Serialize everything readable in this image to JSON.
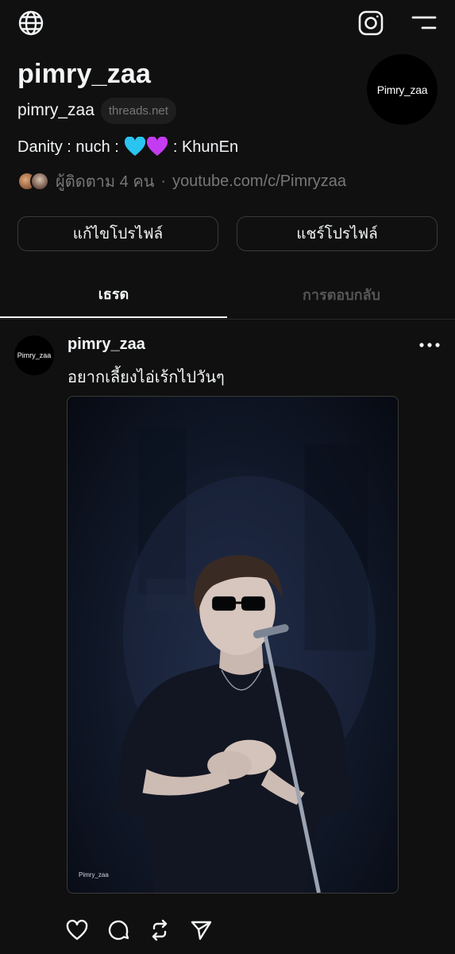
{
  "header": {
    "display_name": "pimry_zaa",
    "handle": "pimry_zaa",
    "domain": "threads.net",
    "avatar_text": "Pimry_zaa",
    "bio_prefix": "Danity : nuch :",
    "bio_suffix": ": KhunEn",
    "followers_text": "ผู้ติดตาม 4 คน",
    "separator": "·",
    "link": "youtube.com/c/Pimryzaa"
  },
  "buttons": {
    "edit_profile": "แก้ไขโปรไฟล์",
    "share_profile": "แชร์โปรไฟล์"
  },
  "tabs": [
    {
      "label": "เธรด",
      "active": true
    },
    {
      "label": "การตอบกลับ",
      "active": false
    }
  ],
  "post": {
    "avatar_text": "Pimry_zaa",
    "username": "pimry_zaa",
    "text": "อยากเลี้ยงไอ่เร้กไปวันๆ",
    "image_watermark": "Pimry_zaa"
  },
  "icons": {
    "top_left": "globe-icon",
    "top_right_1": "instagram-icon",
    "top_right_2": "menu-icon",
    "post_actions": [
      "heart-icon",
      "comment-icon",
      "repost-icon",
      "send-icon"
    ]
  },
  "colors": {
    "background": "#101010",
    "text": "#f3f5f7",
    "muted": "#777777",
    "heart_blue": "#29c4f0",
    "heart_purple": "#c43cf2"
  }
}
